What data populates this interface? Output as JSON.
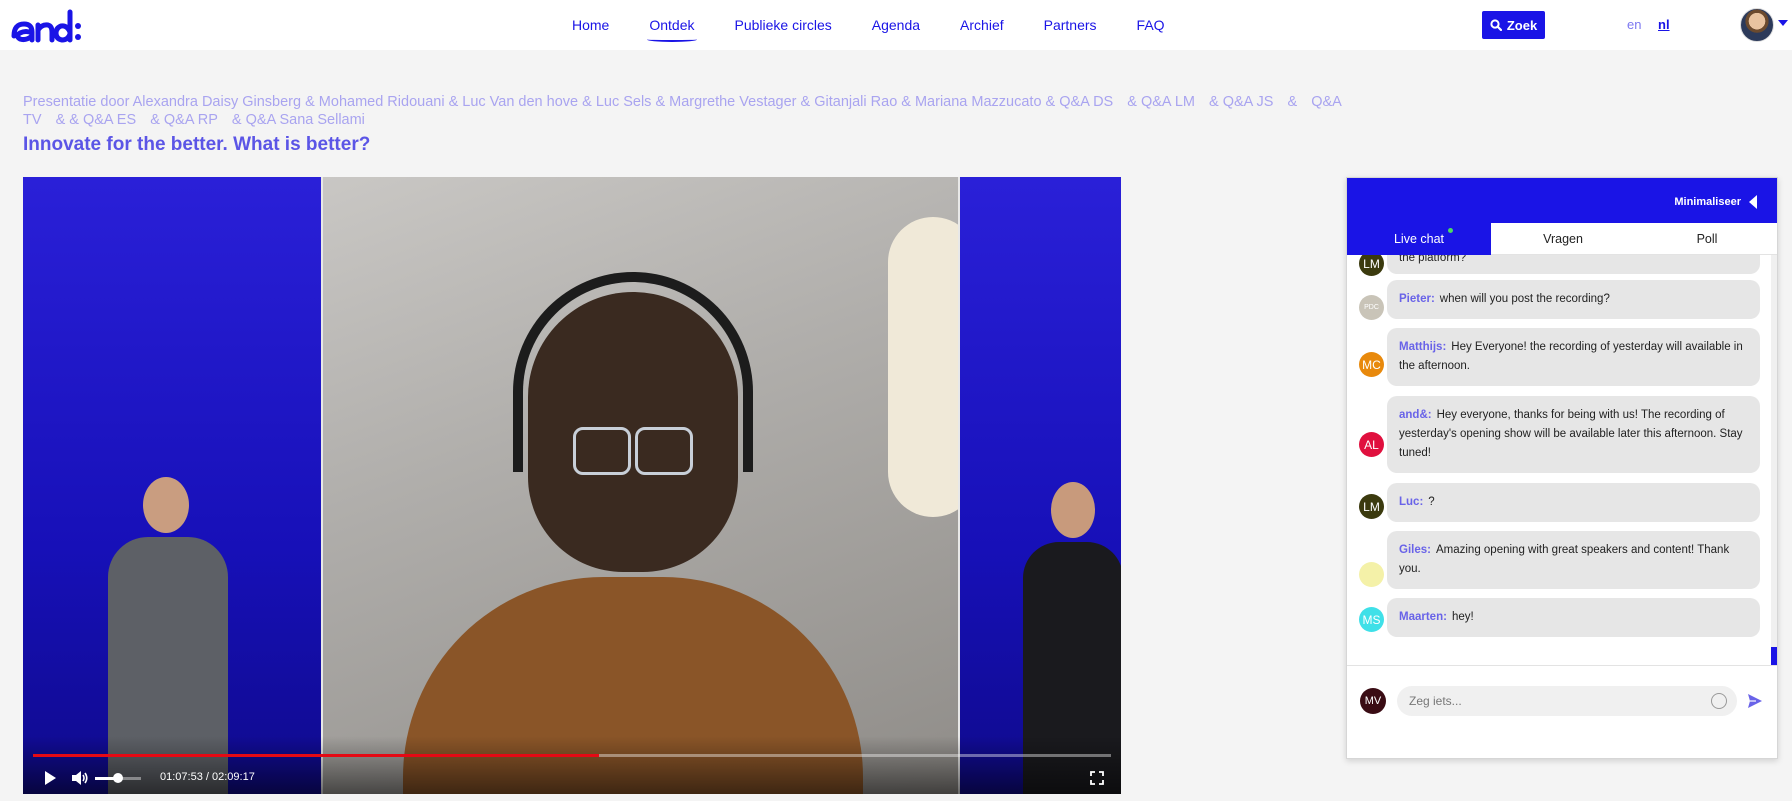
{
  "brand": {
    "logo_alt": "and&",
    "accent": "#1a14e6"
  },
  "nav": {
    "items": [
      {
        "label": "Home"
      },
      {
        "label": "Ontdek",
        "active": true
      },
      {
        "label": "Publieke circles"
      },
      {
        "label": "Agenda"
      },
      {
        "label": "Archief"
      },
      {
        "label": "Partners"
      },
      {
        "label": "FAQ"
      }
    ]
  },
  "search": {
    "label": "Zoek"
  },
  "languages": {
    "en": "en",
    "nl": "nl",
    "active": "nl"
  },
  "session": {
    "presenters": [
      "Presentatie door Alexandra Daisy Ginsberg & Mohamed Ridouani & Luc Van den hove & Luc Sels & Margrethe Vestager & Gitanjali Rao & Mariana Mazzucato & Q&A DS",
      "& Q&A LM",
      "& Q&A JS",
      "&",
      "Q&A TV",
      "& & Q&A ES",
      "& Q&A RP",
      "& Q&A Sana Sellami"
    ],
    "title": "Innovate for the better. What is better?"
  },
  "player": {
    "current_time": "01:07:53",
    "duration": "02:09:17",
    "time_display": "01:07:53 / 02:09:17",
    "progress_fraction": 0.525,
    "volume_fraction": 0.5
  },
  "chat": {
    "minimize_label": "Minimaliseer",
    "tabs": [
      {
        "label": "Live chat",
        "active": true,
        "live": true
      },
      {
        "label": "Vragen"
      },
      {
        "label": "Poll"
      }
    ],
    "messages": [
      {
        "initials": "LM",
        "avatar_color": "#3b3a0e",
        "author": "",
        "text": "the platform?",
        "partial": true
      },
      {
        "initials": "PDC",
        "avatar_color": "#c9c4b8",
        "author": "Pieter:",
        "text": "when will you post the recording?"
      },
      {
        "initials": "MC",
        "avatar_color": "#e8890c",
        "author": "Matthijs:",
        "text": "Hey Everyone! the recording of yesterday will available in the afternoon."
      },
      {
        "initials": "AL",
        "avatar_color": "#e0103e",
        "author": "and&:",
        "text": "Hey everyone, thanks for being with us! The recording of yesterday's opening show will be available later this afternoon. Stay tuned!"
      },
      {
        "initials": "LM",
        "avatar_color": "#3b3a0e",
        "author": "Luc:",
        "text": "?"
      },
      {
        "initials": "",
        "avatar_color": "#f4f1a8",
        "author": "Giles:",
        "text": "Amazing opening with great speakers and content! Thank you."
      },
      {
        "initials": "MS",
        "avatar_color": "#3fe0e8",
        "author": "Maarten:",
        "text": "hey!"
      }
    ],
    "composer": {
      "user_initials": "MV",
      "placeholder": "Zeg iets..."
    }
  }
}
